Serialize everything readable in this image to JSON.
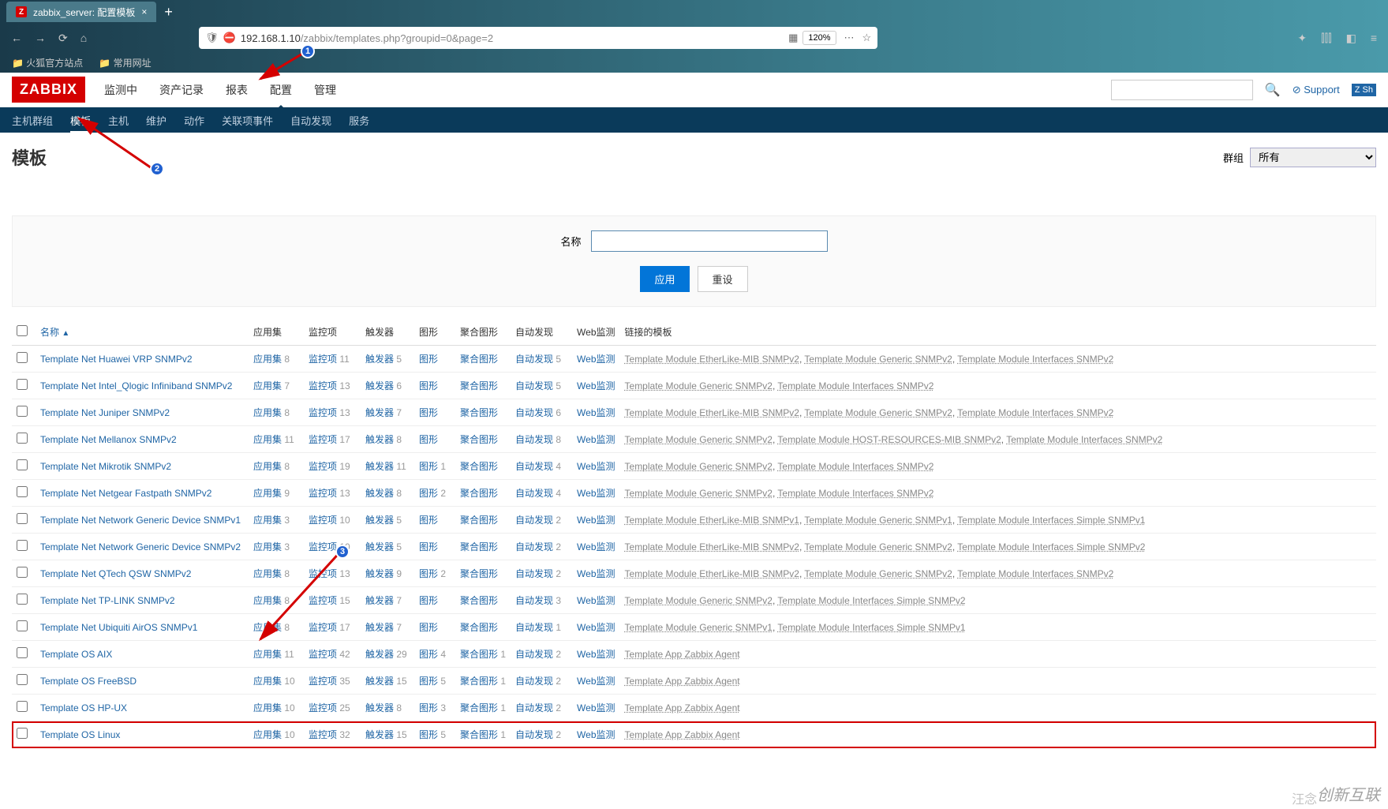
{
  "browser": {
    "tab_title": "zabbix_server: 配置模板",
    "tab_favicon": "Z",
    "url_host": "192.168.1.10",
    "url_path": "/zabbix/templates.php?groupid=0&page=2",
    "zoom": "120%",
    "bookmarks": [
      "火狐官方站点",
      "常用网址"
    ]
  },
  "zabbix": {
    "logo": "ZABBIX",
    "main_nav": [
      "监测中",
      "资产记录",
      "报表",
      "配置",
      "管理"
    ],
    "support": "Support",
    "share": "Sh",
    "secondary_nav": [
      "主机群组",
      "模板",
      "主机",
      "维护",
      "动作",
      "关联项事件",
      "自动发现",
      "服务"
    ],
    "page_title": "模板",
    "group_label": "群组",
    "group_value": "所有"
  },
  "filter": {
    "name_label": "名称",
    "name_value": "",
    "apply": "应用",
    "reset": "重设"
  },
  "table": {
    "headers": {
      "name": "名称",
      "apps": "应用集",
      "items": "监控项",
      "triggers": "触发器",
      "graphs": "图形",
      "screens": "聚合图形",
      "discovery": "自动发现",
      "web": "Web监测",
      "linked": "链接的模板"
    },
    "rows": [
      {
        "name": "Template Net Huawei VRP SNMPv2",
        "apps": 8,
        "items": 11,
        "triggers": 5,
        "graphs": "",
        "screens": "",
        "discovery": 5,
        "linked": "Template Module EtherLike-MIB SNMPv2, Template Module Generic SNMPv2, Template Module Interfaces SNMPv2"
      },
      {
        "name": "Template Net Intel_Qlogic Infiniband SNMPv2",
        "apps": 7,
        "items": 13,
        "triggers": 6,
        "graphs": "",
        "screens": "",
        "discovery": 5,
        "linked": "Template Module Generic SNMPv2, Template Module Interfaces SNMPv2"
      },
      {
        "name": "Template Net Juniper SNMPv2",
        "apps": 8,
        "items": 13,
        "triggers": 7,
        "graphs": "",
        "screens": "",
        "discovery": 6,
        "linked": "Template Module EtherLike-MIB SNMPv2, Template Module Generic SNMPv2, Template Module Interfaces SNMPv2"
      },
      {
        "name": "Template Net Mellanox SNMPv2",
        "apps": 11,
        "items": 17,
        "triggers": 8,
        "graphs": "",
        "screens": "",
        "discovery": 8,
        "linked": "Template Module Generic SNMPv2, Template Module HOST-RESOURCES-MIB SNMPv2, Template Module Interfaces SNMPv2"
      },
      {
        "name": "Template Net Mikrotik SNMPv2",
        "apps": 8,
        "items": 19,
        "triggers": 11,
        "graphs": 1,
        "screens": "",
        "discovery": 4,
        "linked": "Template Module Generic SNMPv2, Template Module Interfaces SNMPv2"
      },
      {
        "name": "Template Net Netgear Fastpath SNMPv2",
        "apps": 9,
        "items": 13,
        "triggers": 8,
        "graphs": 2,
        "screens": "",
        "discovery": 4,
        "linked": "Template Module Generic SNMPv2, Template Module Interfaces SNMPv2"
      },
      {
        "name": "Template Net Network Generic Device SNMPv1",
        "apps": 3,
        "items": 10,
        "triggers": 5,
        "graphs": "",
        "screens": "",
        "discovery": 2,
        "linked": "Template Module EtherLike-MIB SNMPv1, Template Module Generic SNMPv1, Template Module Interfaces Simple SNMPv1"
      },
      {
        "name": "Template Net Network Generic Device SNMPv2",
        "apps": 3,
        "items": 10,
        "triggers": 5,
        "graphs": "",
        "screens": "",
        "discovery": 2,
        "linked": "Template Module EtherLike-MIB SNMPv2, Template Module Generic SNMPv2, Template Module Interfaces Simple SNMPv2"
      },
      {
        "name": "Template Net QTech QSW SNMPv2",
        "apps": 8,
        "items": 13,
        "triggers": 9,
        "graphs": 2,
        "screens": "",
        "discovery": 2,
        "linked": "Template Module EtherLike-MIB SNMPv2, Template Module Generic SNMPv2, Template Module Interfaces SNMPv2"
      },
      {
        "name": "Template Net TP-LINK SNMPv2",
        "apps": 8,
        "items": 15,
        "triggers": 7,
        "graphs": "",
        "screens": "",
        "discovery": 3,
        "linked": "Template Module Generic SNMPv2, Template Module Interfaces Simple SNMPv2"
      },
      {
        "name": "Template Net Ubiquiti AirOS SNMPv1",
        "apps": 8,
        "items": 17,
        "triggers": 7,
        "graphs": "",
        "screens": "",
        "discovery": 1,
        "linked": "Template Module Generic SNMPv1, Template Module Interfaces Simple SNMPv1"
      },
      {
        "name": "Template OS AIX",
        "apps": 11,
        "items": 42,
        "triggers": 29,
        "graphs": 4,
        "screens": 1,
        "discovery": 2,
        "linked": "Template App Zabbix Agent"
      },
      {
        "name": "Template OS FreeBSD",
        "apps": 10,
        "items": 35,
        "triggers": 15,
        "graphs": 5,
        "screens": 1,
        "discovery": 2,
        "linked": "Template App Zabbix Agent"
      },
      {
        "name": "Template OS HP-UX",
        "apps": 10,
        "items": 25,
        "triggers": 8,
        "graphs": 3,
        "screens": 1,
        "discovery": 2,
        "linked": "Template App Zabbix Agent"
      },
      {
        "name": "Template OS Linux",
        "apps": 10,
        "items": 32,
        "triggers": 15,
        "graphs": 5,
        "screens": 1,
        "discovery": 2,
        "linked": "Template App Zabbix Agent",
        "hl": true
      }
    ],
    "apps_label": "应用集",
    "items_label": "监控项",
    "triggers_label": "触发器",
    "graphs_label": "图形",
    "screens_label": "聚合图形",
    "discovery_label": "自动发现",
    "web_label": "Web监测"
  },
  "watermark": "创新互联",
  "watermark2": "汪念"
}
